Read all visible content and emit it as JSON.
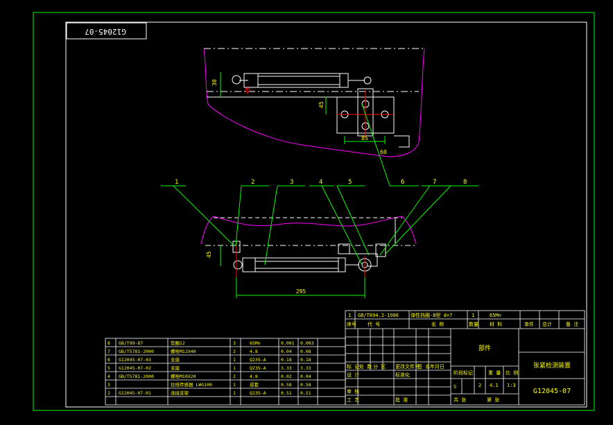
{
  "drawing": {
    "number_stamp": "G12045-07",
    "drawing_number": "G12045-07",
    "drawing_title": "张紧检测装置",
    "assembly_label": "部件"
  },
  "colors": {
    "background": "#000000",
    "frame": "#00ff00",
    "outline": "#ffffff",
    "contour": "#ff00ff",
    "center": "#ff0000",
    "leader": "#00ff00",
    "text": "#ffff00"
  },
  "callouts": [
    "1",
    "2",
    "3",
    "4",
    "5",
    "6",
    "7",
    "8"
  ],
  "dimensions": {
    "top_height": "30",
    "top_offset": "45",
    "top_width": "85",
    "top_angle": "60",
    "front_height": "45",
    "front_length": "295"
  },
  "bom_top": {
    "number": "1",
    "code": "GB/T894.2-1986",
    "name": "弹性挡圈-B型 d=7",
    "qty": "1",
    "material": "65Mn",
    "header": [
      "序号",
      "代 号",
      "名 称",
      "数量",
      "材 料",
      "单件",
      "总计",
      "备 注"
    ]
  },
  "bom": [
    {
      "no": "8",
      "code": "GB/T99-87",
      "name": "垫圈12",
      "qty": "3",
      "material": "65Mn",
      "unit": "0.001",
      "total": "0.003"
    },
    {
      "no": "7",
      "code": "GB/T5781-2000",
      "name": "螺栓M12X40",
      "qty": "2",
      "material": "4.8",
      "unit": "0.04",
      "total": "0.08"
    },
    {
      "no": "6",
      "code": "G12045-07-03",
      "name": "支座",
      "qty": "1",
      "material": "Q235-A",
      "unit": "0.18",
      "total": "0.18"
    },
    {
      "no": "5",
      "code": "G12045-07-02",
      "name": "支座",
      "qty": "1",
      "material": "Q235-A",
      "unit": "3.33",
      "total": "3.33"
    },
    {
      "no": "4",
      "code": "GB/T5781-2000",
      "name": "螺栓M10X20",
      "qty": "2",
      "material": "4.8",
      "unit": "0.02",
      "total": "0.04"
    },
    {
      "no": "3",
      "code": "",
      "name": "拉线传感器 LWG100",
      "qty": "1",
      "material": "成套",
      "unit": "0.58",
      "total": "0.58"
    },
    {
      "no": "2",
      "code": "G12045-07-01",
      "name": "连接支架",
      "qty": "1",
      "material": "Q235-A",
      "unit": "0.51",
      "total": "0.51"
    }
  ],
  "title_block": {
    "marks_label": "标 记",
    "count_label": "处 数",
    "zone_label": "分 区",
    "change_doc_label": "更改文件号",
    "sign_label": "签 名",
    "date_label": "年月日",
    "design_label": "设 计",
    "standard_label": "标准化",
    "check_label": "审 核",
    "process_label": "工 艺",
    "approve_label": "批 准",
    "stage_label": "阶段标记",
    "weight_label": "重 量",
    "scale_label": "比 例",
    "stage_value": "S",
    "weight_value": "4.1",
    "scale_value": "1:3",
    "sheet_count_value": "2",
    "sheets_label": "共 张",
    "sheet_label": "第 张"
  }
}
